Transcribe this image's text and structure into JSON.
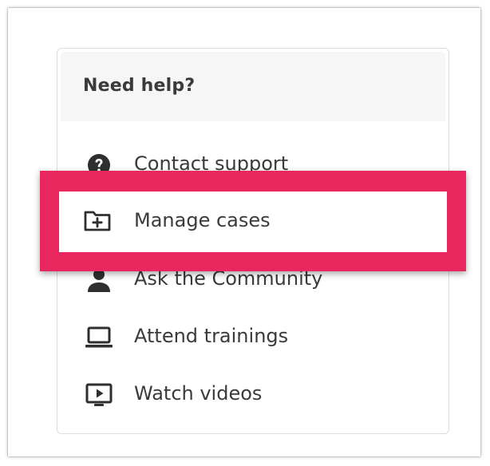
{
  "help_panel": {
    "title": "Need help?",
    "items": [
      {
        "label": "Contact support",
        "icon": "question-circle-icon"
      },
      {
        "label": "Manage cases",
        "icon": "folder-plus-icon"
      },
      {
        "label": "Ask the Community",
        "icon": "person-icon"
      },
      {
        "label": "Attend trainings",
        "icon": "laptop-icon"
      },
      {
        "label": "Watch videos",
        "icon": "video-play-icon"
      }
    ]
  },
  "highlight": {
    "color": "#e8275f",
    "target": "Manage cases"
  }
}
